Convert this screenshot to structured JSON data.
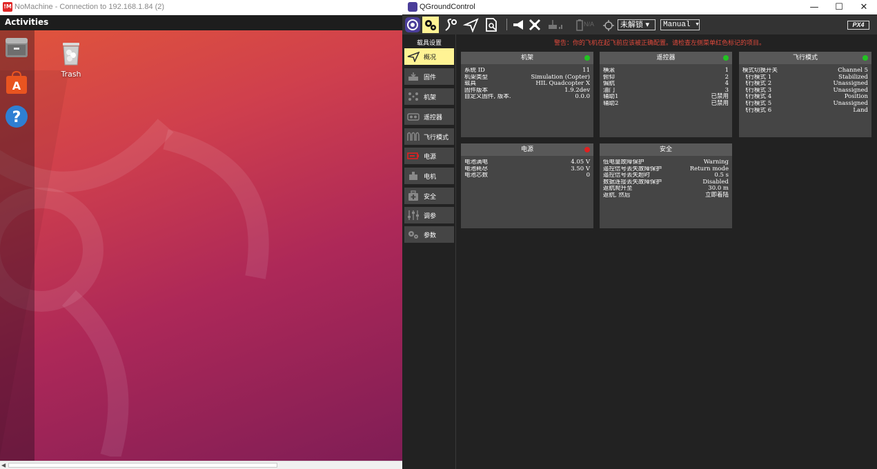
{
  "nomachine": {
    "logo": "!M",
    "title": "NoMachine - Connection to 192.168.1.84 (2)"
  },
  "ubuntu": {
    "activities": "Activities",
    "dock": [
      {
        "name": "files-icon"
      },
      {
        "name": "ubuntu-software-icon"
      },
      {
        "name": "help-icon"
      }
    ],
    "trash_label": "Trash"
  },
  "qgc": {
    "title": "QGroundControl",
    "window_controls": {
      "minimize": "—",
      "maximize": "☐",
      "close": "✕"
    },
    "toolbar": {
      "battery_text": "N/A",
      "arm_status": "未解锁",
      "flight_mode": "Manual",
      "logo": "PX4"
    },
    "sidebar": {
      "title": "载具设置",
      "items": [
        {
          "label": "概况",
          "icon": "plane-icon",
          "active": true
        },
        {
          "label": "固件",
          "icon": "firmware-icon",
          "active": false
        },
        {
          "label": "机架",
          "icon": "airframe-icon",
          "active": false
        },
        {
          "label": "遥控器",
          "icon": "radio-icon",
          "active": false
        },
        {
          "label": "飞行模式",
          "icon": "flight-modes-icon",
          "active": false
        },
        {
          "label": "电源",
          "icon": "battery-icon",
          "active": false
        },
        {
          "label": "电机",
          "icon": "motor-icon",
          "active": false
        },
        {
          "label": "安全",
          "icon": "safety-icon",
          "active": false
        },
        {
          "label": "调参",
          "icon": "tuning-icon",
          "active": false
        },
        {
          "label": "参数",
          "icon": "parameters-icon",
          "active": false
        }
      ]
    },
    "warning": "警告：你的飞机在起飞前应该被正确配置。请检查左侧菜单红色标记的项目。",
    "colors": {
      "ok": "#22c322",
      "error": "#e02020",
      "accent": "#fff394"
    },
    "panels": {
      "airframe": {
        "title": "机架",
        "status": "ok",
        "rows": [
          {
            "k": "系统 ID",
            "v": "11"
          },
          {
            "k": "机架类型",
            "v": "Simulation (Copter)"
          },
          {
            "k": "载具",
            "v": "HIL Quadcopter X"
          },
          {
            "k": "固件版本",
            "v": "1.9.2dev"
          },
          {
            "k": "自定义固件, 版本.",
            "v": "0.0.0"
          }
        ]
      },
      "radio": {
        "title": "遥控器",
        "status": "ok",
        "rows": [
          {
            "k": "横滚",
            "v": "1"
          },
          {
            "k": "俯仰",
            "v": "2"
          },
          {
            "k": "偏航",
            "v": "4"
          },
          {
            "k": "油门",
            "v": "3"
          },
          {
            "k": "辅助1",
            "v": "已禁用"
          },
          {
            "k": "辅助2",
            "v": "已禁用"
          }
        ]
      },
      "flight_modes": {
        "title": "飞行模式",
        "status": "ok",
        "rows": [
          {
            "k": "模式切换开关",
            "v": "Channel 5"
          },
          {
            "k": "飞行模式 1",
            "v": "Stabilized"
          },
          {
            "k": "飞行模式 2",
            "v": "Unassigned"
          },
          {
            "k": "飞行模式 3",
            "v": "Unassigned"
          },
          {
            "k": "飞行模式 4",
            "v": "Position"
          },
          {
            "k": "飞行模式 5",
            "v": "Unassigned"
          },
          {
            "k": "飞行模式 6",
            "v": "Land"
          }
        ]
      },
      "power": {
        "title": "电源",
        "status": "error",
        "rows": [
          {
            "k": "电池满电",
            "v": "4.05 V"
          },
          {
            "k": "电池耗尽",
            "v": "3.50 V"
          },
          {
            "k": "电池芯数",
            "v": "0"
          }
        ]
      },
      "safety": {
        "title": "安全",
        "status": "none",
        "rows": [
          {
            "k": "低电量故障保护",
            "v": "Warning"
          },
          {
            "k": "遥控信号丢失故障保护",
            "v": "Return mode"
          },
          {
            "k": "遥控信号丢失超时",
            "v": "0.5 s"
          },
          {
            "k": "数据连接丢失故障保护",
            "v": "Disabled"
          },
          {
            "k": "返航爬升至",
            "v": "30.0 m"
          },
          {
            "k": "返航, 然后",
            "v": "立即着陆"
          }
        ]
      }
    }
  }
}
